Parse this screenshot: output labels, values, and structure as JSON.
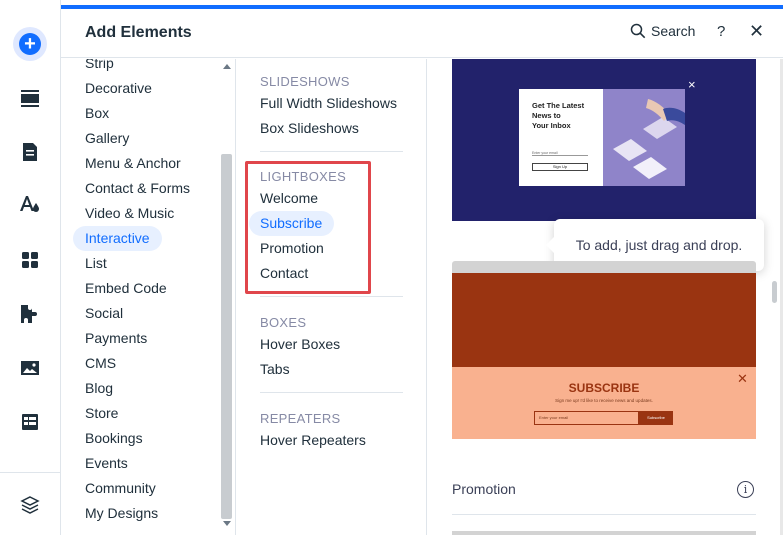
{
  "panel": {
    "title": "Add Elements",
    "search_label": "Search",
    "help_label": "?",
    "close_label": "✕"
  },
  "rail": {
    "icons": [
      "add-icon",
      "sections-icon",
      "pages-icon",
      "theme-icon",
      "apps-icon",
      "business-icon",
      "media-icon",
      "cms-icon",
      "layers-icon"
    ]
  },
  "categories": [
    {
      "label": "Strip"
    },
    {
      "label": "Decorative"
    },
    {
      "label": "Box"
    },
    {
      "label": "Gallery"
    },
    {
      "label": "Menu & Anchor"
    },
    {
      "label": "Contact & Forms"
    },
    {
      "label": "Video & Music"
    },
    {
      "label": "Interactive",
      "active": true
    },
    {
      "label": "List"
    },
    {
      "label": "Embed Code"
    },
    {
      "label": "Social"
    },
    {
      "label": "Payments"
    },
    {
      "label": "CMS"
    },
    {
      "label": "Blog"
    },
    {
      "label": "Store"
    },
    {
      "label": "Bookings"
    },
    {
      "label": "Events"
    },
    {
      "label": "Community"
    },
    {
      "label": "My Designs"
    }
  ],
  "subcategories": {
    "slideshows": {
      "heading": "SLIDESHOWS",
      "items": [
        "Full Width Slideshows",
        "Box Slideshows"
      ]
    },
    "lightboxes": {
      "heading": "LIGHTBOXES",
      "items": [
        "Welcome",
        "Subscribe",
        "Promotion",
        "Contact"
      ],
      "active": "Subscribe"
    },
    "boxes": {
      "heading": "BOXES",
      "items": [
        "Hover Boxes",
        "Tabs"
      ]
    },
    "repeaters": {
      "heading": "REPEATERS",
      "items": [
        "Hover Repeaters"
      ]
    }
  },
  "preview": {
    "card1": {
      "title_lines": [
        "Get The Latest",
        "News to",
        "Your Inbox"
      ],
      "input_placeholder": "Enter your email",
      "button_label": "Sign Up",
      "close": "×"
    },
    "tooltip": "To add, just drag and drop.",
    "card2": {
      "title": "SUBSCRIBE",
      "text": "Sign me up! I'd like to receive news and updates.",
      "input_placeholder": "Enter your email",
      "button_label": "Subscribe",
      "close": "✕"
    },
    "section_label": "Promotion",
    "info_icon": "i"
  },
  "colors": {
    "accent": "#116dff",
    "highlight_border": "#e0464b",
    "card1_bg": "#22226b",
    "card2_top": "#9a3411",
    "card2_bottom": "#f9b18f"
  }
}
